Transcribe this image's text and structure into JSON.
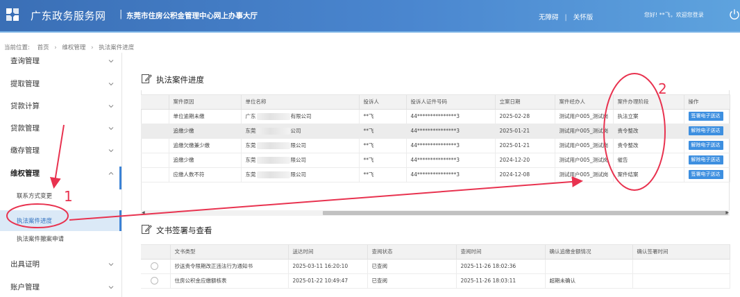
{
  "header": {
    "site_title": "广东政务服务网",
    "separator": "|",
    "center_name": "东莞市住房公积金管理中心网上办事大厅",
    "accessible": "无障碍",
    "access_divider": "|",
    "elder_mode": "关怀版",
    "greeting": "您好! **飞，欢迎您登录"
  },
  "breadcrumb": {
    "prefix": "当前位置:",
    "items": [
      "首页",
      "维权管理",
      "执法案件进度"
    ]
  },
  "sidebar": {
    "items": [
      {
        "label": "查询管理"
      },
      {
        "label": "提取管理"
      },
      {
        "label": "贷款计算"
      },
      {
        "label": "贷款管理"
      },
      {
        "label": "缴存管理"
      },
      {
        "label": "维权管理"
      }
    ],
    "sub_items": [
      {
        "label": "联系方式变更"
      },
      {
        "label": "执法案件进度"
      },
      {
        "label": "执法案件撤案申请"
      }
    ],
    "items_after": [
      {
        "label": "出具证明"
      },
      {
        "label": "账户管理"
      }
    ]
  },
  "case_section": {
    "title": "执法案件进度",
    "columns": [
      "案件原因",
      "单位名称",
      "投诉人",
      "投诉人证件号码",
      "立案日期",
      "案件经办人",
      "案件办理阶段",
      "操作"
    ],
    "rows": [
      {
        "reason": "单位逾期未缴",
        "unit_prefix": "广东",
        "unit_suffix": "有限公司",
        "complainant": "**飞",
        "id_no": "44***************3",
        "date": "2025-02-28",
        "handler": "测试用户005_测试岗",
        "stage": "执法立案",
        "op": "签署电子送达"
      },
      {
        "reason": "追缴少缴",
        "unit_prefix": "东莞",
        "unit_suffix": "公司",
        "complainant": "**飞",
        "id_no": "44***************3",
        "date": "2025-01-21",
        "handler": "测试用户005_测试岗",
        "stage": "责令整改",
        "op": "解除电子送达"
      },
      {
        "reason": "追缴欠缴兼少缴",
        "unit_prefix": "东莞",
        "unit_suffix": "限公司",
        "complainant": "**飞",
        "id_no": "44***************3",
        "date": "2025-01-21",
        "handler": "测试用户005_测试岗",
        "stage": "责令整改",
        "op": "解除电子送达"
      },
      {
        "reason": "追缴少缴",
        "unit_prefix": "东莞",
        "unit_suffix": "限公司",
        "complainant": "**飞",
        "id_no": "44***************3",
        "date": "2024-12-20",
        "handler": "测试用户005_测试岗",
        "stage": "催告",
        "op": "解除电子送达"
      },
      {
        "reason": "应缴人数不符",
        "unit_prefix": "东莞",
        "unit_suffix": "限公司",
        "complainant": "**飞",
        "id_no": "44***************3",
        "date": "2024-12-08",
        "handler": "测试用户005_测试岗",
        "stage": "案件结案",
        "op": "签署电子送达"
      }
    ]
  },
  "doc_section": {
    "title": "文书签署与查看",
    "columns": [
      "",
      "文书类型",
      "送达时间",
      "查阅状态",
      "查阅时间",
      "确认追缴金额情况",
      "确认签署时间"
    ],
    "rows": [
      {
        "type": "抄送责令限期改正违法行为通知书",
        "sent": "2025-03-11 16:20:10",
        "status": "已查阅",
        "read_time": "2025-11-26 18:02:36",
        "confirm": "",
        "sign_time": ""
      },
      {
        "type": "住房公积金应缴额核表",
        "sent": "2025-01-22 10:49:47",
        "status": "已查阅",
        "read_time": "2025-11-26 18:03:11",
        "confirm": "超期未确认",
        "sign_time": ""
      }
    ]
  },
  "annotations": {
    "num1": "1",
    "num2": "2"
  },
  "colors": {
    "accent": "#3b82d6",
    "annotation": "#e8324f",
    "header_start": "#3a6fb6",
    "header_end": "#5ea3de"
  }
}
